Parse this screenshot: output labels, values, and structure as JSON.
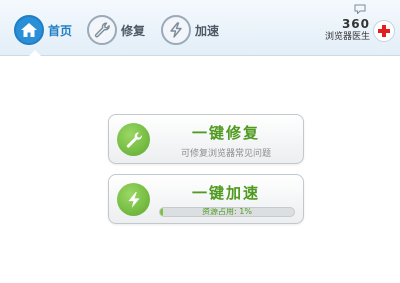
{
  "tabs": [
    {
      "label": "首页",
      "icon": "home-icon",
      "active": true
    },
    {
      "label": "修复",
      "icon": "wrench-icon",
      "active": false
    },
    {
      "label": "加速",
      "icon": "lightning-icon",
      "active": false
    }
  ],
  "brand": {
    "number": "360",
    "name": "浏览器医生",
    "icon": "red-cross-icon"
  },
  "cards": {
    "repair": {
      "title": "一键修复",
      "description": "可修复浏览器常见问题",
      "icon": "wrench-icon"
    },
    "speed": {
      "title": "一键加速",
      "progress_label": "资源占用: 1%",
      "progress": 0.01,
      "icon": "lightning-icon"
    }
  },
  "colors": {
    "accent_blue": "#1f7ec4",
    "accent_green": "#4f9a1f",
    "cross_red": "#e02020"
  }
}
